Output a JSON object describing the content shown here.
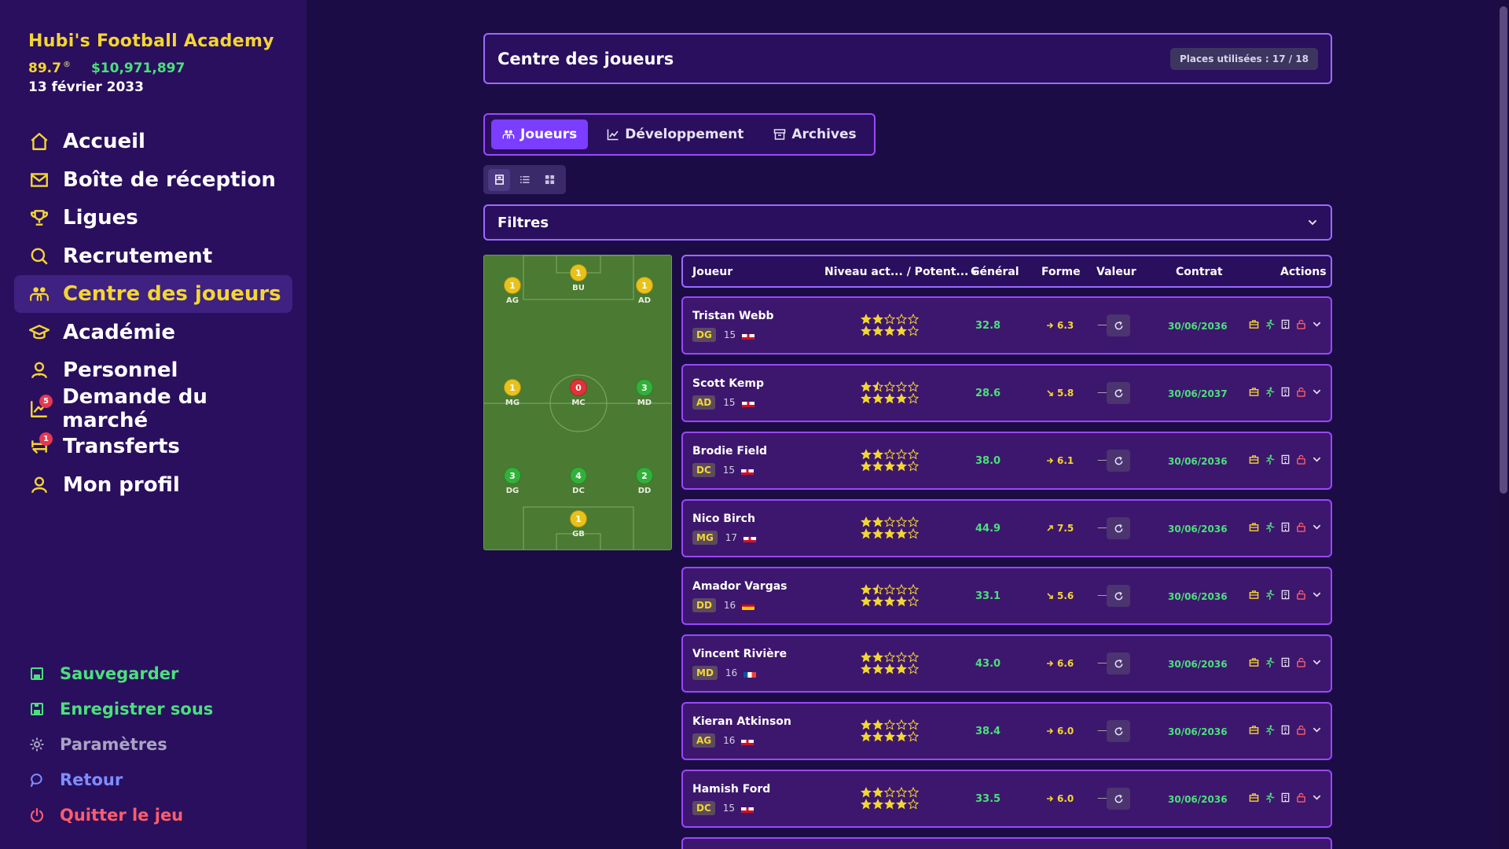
{
  "brand": {
    "name": "Hubi's Football Academy",
    "rating": "89.7",
    "rating_mark": "®",
    "money": "$10,971,897",
    "date": "13 février 2033"
  },
  "nav": {
    "items": [
      {
        "label": "Accueil",
        "icon": "home-icon"
      },
      {
        "label": "Boîte de réception",
        "icon": "mail-icon"
      },
      {
        "label": "Ligues",
        "icon": "trophy-icon"
      },
      {
        "label": "Recrutement",
        "icon": "search-icon"
      },
      {
        "label": "Centre des joueurs",
        "icon": "players-icon",
        "active": true
      },
      {
        "label": "Académie",
        "icon": "graduation-cap-icon"
      },
      {
        "label": "Personnel",
        "icon": "staff-icon"
      },
      {
        "label": "Demande du marché",
        "icon": "chart-up-icon",
        "badge": "5"
      },
      {
        "label": "Transferts",
        "icon": "transfer-icon",
        "badge": "1"
      },
      {
        "label": "Mon profil",
        "icon": "user-icon"
      }
    ]
  },
  "bottom_nav": {
    "items": [
      {
        "label": "Sauvegarder",
        "icon": "save-icon",
        "color": "#4be07b"
      },
      {
        "label": "Enregistrer sous",
        "icon": "save-as-icon",
        "color": "#4be07b"
      },
      {
        "label": "Paramètres",
        "icon": "gear-icon",
        "color": "#a9a3c2"
      },
      {
        "label": "Retour",
        "icon": "back-bubble-icon",
        "color": "#7d8dff"
      },
      {
        "label": "Quitter le jeu",
        "icon": "power-icon",
        "color": "#ff5d6b"
      }
    ]
  },
  "header": {
    "title": "Centre des joueurs",
    "places": "Places utilisées : 17 / 18"
  },
  "tabs": [
    {
      "label": "Joueurs",
      "icon": "players-icon",
      "active": true
    },
    {
      "label": "Développement",
      "icon": "line-chart-icon"
    },
    {
      "label": "Archives",
      "icon": "archive-icon"
    }
  ],
  "filters": {
    "label": "Filtres"
  },
  "pitch": {
    "positions": [
      {
        "label": "BU",
        "count": "1",
        "color": "#e8c21a"
      },
      {
        "label": "AG",
        "count": "1",
        "color": "#e8c21a"
      },
      {
        "label": "AD",
        "count": "1",
        "color": "#e8c21a"
      },
      {
        "label": "MG",
        "count": "1",
        "color": "#e8c21a"
      },
      {
        "label": "MC",
        "count": "0",
        "color": "#e0333a"
      },
      {
        "label": "MD",
        "count": "3",
        "color": "#33b03a"
      },
      {
        "label": "DG",
        "count": "3",
        "color": "#33b03a"
      },
      {
        "label": "DC",
        "count": "4",
        "color": "#33b03a"
      },
      {
        "label": "DD",
        "count": "2",
        "color": "#33b03a"
      },
      {
        "label": "GB",
        "count": "1",
        "color": "#e8c21a"
      }
    ]
  },
  "table": {
    "headers": {
      "player": "Joueur",
      "level": "Niveau act... / Potent...",
      "overall": "Général",
      "form": "Forme",
      "value": "Valeur",
      "contract": "Contrat",
      "actions": "Actions"
    },
    "rows": [
      {
        "name": "Tristan Webb",
        "pos": "DG",
        "age": "15",
        "flag": "england",
        "current_stars": 2,
        "potential_stars": 4,
        "overall": "32.8",
        "form": "6.3",
        "trend": "flat",
        "value": "—",
        "contract": "30/06/2036"
      },
      {
        "name": "Scott Kemp",
        "pos": "AD",
        "age": "15",
        "flag": "england",
        "current_stars": 1.5,
        "potential_stars": 4,
        "overall": "28.6",
        "form": "5.8",
        "trend": "down",
        "value": "—",
        "contract": "30/06/2037"
      },
      {
        "name": "Brodie Field",
        "pos": "DC",
        "age": "15",
        "flag": "england",
        "current_stars": 2,
        "potential_stars": 4,
        "overall": "38.0",
        "form": "6.1",
        "trend": "flat",
        "value": "—",
        "contract": "30/06/2036"
      },
      {
        "name": "Nico Birch",
        "pos": "MG",
        "age": "17",
        "flag": "england",
        "current_stars": 2,
        "potential_stars": 4,
        "overall": "44.9",
        "form": "7.5",
        "trend": "up",
        "value": "—",
        "contract": "30/06/2036"
      },
      {
        "name": "Amador Vargas",
        "pos": "DD",
        "age": "16",
        "flag": "spain",
        "current_stars": 1.5,
        "potential_stars": 4,
        "overall": "33.1",
        "form": "5.6",
        "trend": "down",
        "value": "—",
        "contract": "30/06/2036"
      },
      {
        "name": "Vincent Rivière",
        "pos": "MD",
        "age": "16",
        "flag": "france",
        "current_stars": 2,
        "potential_stars": 4,
        "overall": "43.0",
        "form": "6.6",
        "trend": "flat",
        "value": "—",
        "contract": "30/06/2036"
      },
      {
        "name": "Kieran Atkinson",
        "pos": "AG",
        "age": "16",
        "flag": "england",
        "current_stars": 2,
        "potential_stars": 4,
        "overall": "38.4",
        "form": "6.0",
        "trend": "flat",
        "value": "—",
        "contract": "30/06/2036"
      },
      {
        "name": "Hamish Ford",
        "pos": "DC",
        "age": "15",
        "flag": "england",
        "current_stars": 2,
        "potential_stars": 4,
        "overall": "33.5",
        "form": "6.0",
        "trend": "flat",
        "value": "—",
        "contract": "30/06/2036"
      }
    ]
  },
  "colors": {
    "accent_yellow": "#f3d630",
    "accent_green": "#4be07b",
    "accent_purple": "#9b47ff",
    "background": "#1c0c45"
  }
}
